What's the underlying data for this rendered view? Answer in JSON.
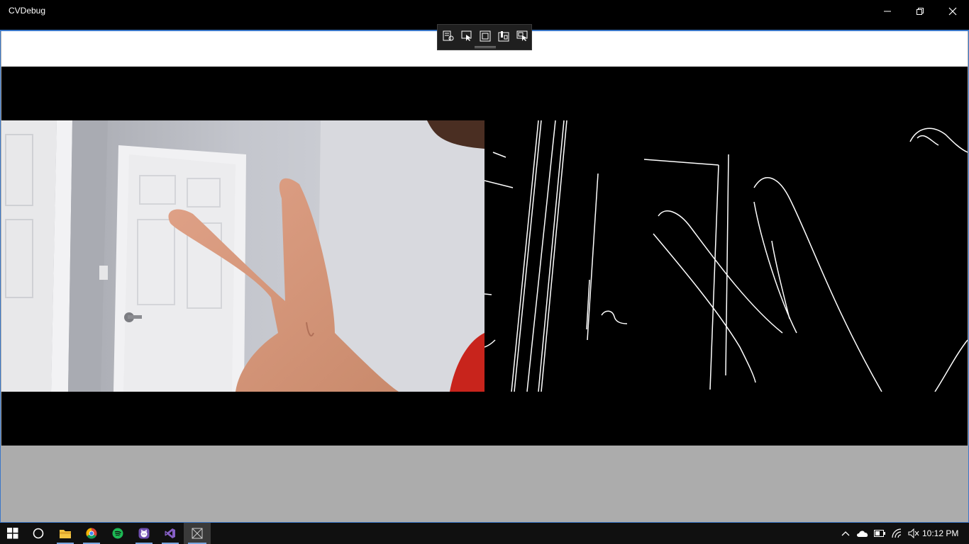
{
  "window": {
    "title": "CVDebug",
    "minimize_icon": "minimize-icon",
    "maximize_icon": "restore-icon",
    "close_icon": "close-icon"
  },
  "debug_toolbar": {
    "buttons": [
      {
        "icon": "live-visual-tree-icon"
      },
      {
        "icon": "select-element-icon"
      },
      {
        "icon": "display-layout-adorners-icon"
      },
      {
        "icon": "track-focused-element-icon"
      },
      {
        "icon": "preview-selection-icon"
      }
    ]
  },
  "panels": {
    "camera": {
      "name": "webcam-frame"
    },
    "edges": {
      "name": "edge-detection-output"
    }
  },
  "taskbar": {
    "items": [
      {
        "icon": "windows-start-icon"
      },
      {
        "icon": "cortana-icon"
      },
      {
        "icon": "file-explorer-icon"
      },
      {
        "icon": "chrome-icon"
      },
      {
        "icon": "spotify-icon"
      },
      {
        "icon": "github-desktop-icon"
      },
      {
        "icon": "visual-studio-icon"
      },
      {
        "icon": "cvdebug-app-icon"
      }
    ],
    "tray": {
      "icons": [
        "show-hidden-icons-icon",
        "onedrive-icon",
        "battery-icon",
        "wifi-icon",
        "volume-muted-icon"
      ],
      "time": "10:12 PM"
    }
  },
  "colors": {
    "accent": "#3b78c9",
    "frame_gray": "#acacac",
    "spotify": "#1db954",
    "vs_purple": "#865fc5"
  }
}
